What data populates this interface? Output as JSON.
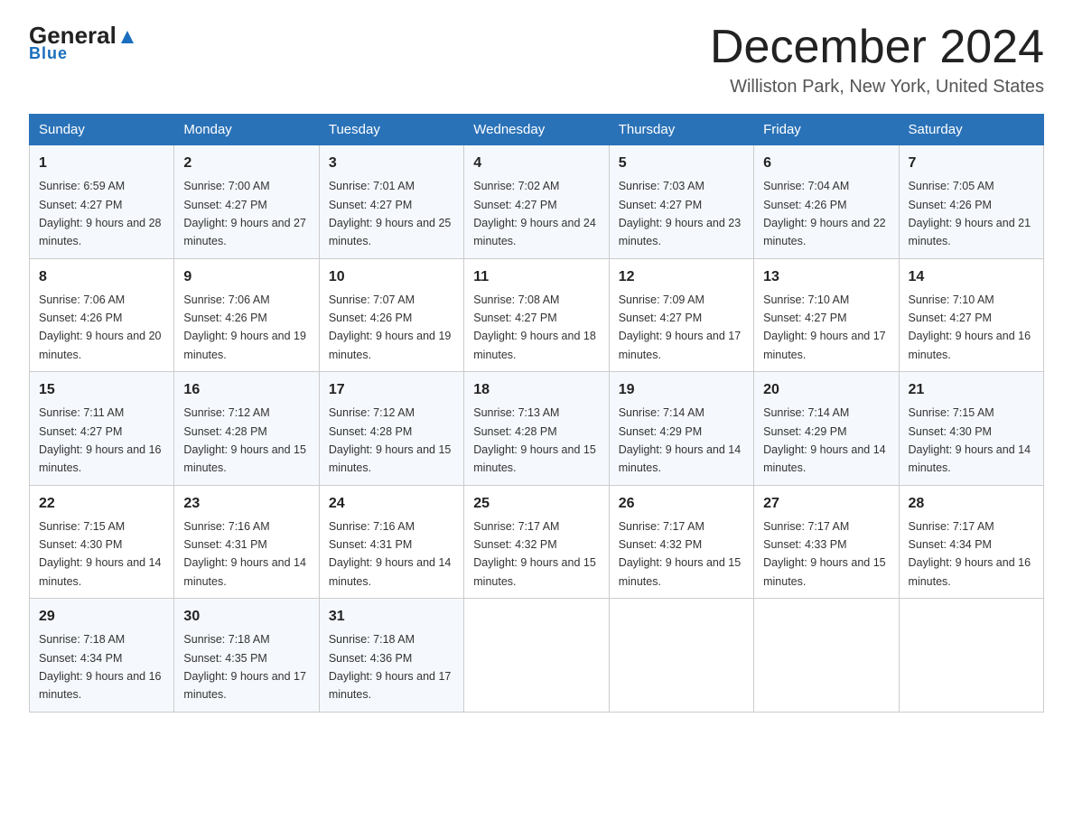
{
  "header": {
    "logo_general": "General",
    "logo_blue": "Blue",
    "month_title": "December 2024",
    "location": "Williston Park, New York, United States"
  },
  "days_of_week": [
    "Sunday",
    "Monday",
    "Tuesday",
    "Wednesday",
    "Thursday",
    "Friday",
    "Saturday"
  ],
  "weeks": [
    [
      {
        "day": "1",
        "sunrise": "6:59 AM",
        "sunset": "4:27 PM",
        "daylight": "9 hours and 28 minutes."
      },
      {
        "day": "2",
        "sunrise": "7:00 AM",
        "sunset": "4:27 PM",
        "daylight": "9 hours and 27 minutes."
      },
      {
        "day": "3",
        "sunrise": "7:01 AM",
        "sunset": "4:27 PM",
        "daylight": "9 hours and 25 minutes."
      },
      {
        "day": "4",
        "sunrise": "7:02 AM",
        "sunset": "4:27 PM",
        "daylight": "9 hours and 24 minutes."
      },
      {
        "day": "5",
        "sunrise": "7:03 AM",
        "sunset": "4:27 PM",
        "daylight": "9 hours and 23 minutes."
      },
      {
        "day": "6",
        "sunrise": "7:04 AM",
        "sunset": "4:26 PM",
        "daylight": "9 hours and 22 minutes."
      },
      {
        "day": "7",
        "sunrise": "7:05 AM",
        "sunset": "4:26 PM",
        "daylight": "9 hours and 21 minutes."
      }
    ],
    [
      {
        "day": "8",
        "sunrise": "7:06 AM",
        "sunset": "4:26 PM",
        "daylight": "9 hours and 20 minutes."
      },
      {
        "day": "9",
        "sunrise": "7:06 AM",
        "sunset": "4:26 PM",
        "daylight": "9 hours and 19 minutes."
      },
      {
        "day": "10",
        "sunrise": "7:07 AM",
        "sunset": "4:26 PM",
        "daylight": "9 hours and 19 minutes."
      },
      {
        "day": "11",
        "sunrise": "7:08 AM",
        "sunset": "4:27 PM",
        "daylight": "9 hours and 18 minutes."
      },
      {
        "day": "12",
        "sunrise": "7:09 AM",
        "sunset": "4:27 PM",
        "daylight": "9 hours and 17 minutes."
      },
      {
        "day": "13",
        "sunrise": "7:10 AM",
        "sunset": "4:27 PM",
        "daylight": "9 hours and 17 minutes."
      },
      {
        "day": "14",
        "sunrise": "7:10 AM",
        "sunset": "4:27 PM",
        "daylight": "9 hours and 16 minutes."
      }
    ],
    [
      {
        "day": "15",
        "sunrise": "7:11 AM",
        "sunset": "4:27 PM",
        "daylight": "9 hours and 16 minutes."
      },
      {
        "day": "16",
        "sunrise": "7:12 AM",
        "sunset": "4:28 PM",
        "daylight": "9 hours and 15 minutes."
      },
      {
        "day": "17",
        "sunrise": "7:12 AM",
        "sunset": "4:28 PM",
        "daylight": "9 hours and 15 minutes."
      },
      {
        "day": "18",
        "sunrise": "7:13 AM",
        "sunset": "4:28 PM",
        "daylight": "9 hours and 15 minutes."
      },
      {
        "day": "19",
        "sunrise": "7:14 AM",
        "sunset": "4:29 PM",
        "daylight": "9 hours and 14 minutes."
      },
      {
        "day": "20",
        "sunrise": "7:14 AM",
        "sunset": "4:29 PM",
        "daylight": "9 hours and 14 minutes."
      },
      {
        "day": "21",
        "sunrise": "7:15 AM",
        "sunset": "4:30 PM",
        "daylight": "9 hours and 14 minutes."
      }
    ],
    [
      {
        "day": "22",
        "sunrise": "7:15 AM",
        "sunset": "4:30 PM",
        "daylight": "9 hours and 14 minutes."
      },
      {
        "day": "23",
        "sunrise": "7:16 AM",
        "sunset": "4:31 PM",
        "daylight": "9 hours and 14 minutes."
      },
      {
        "day": "24",
        "sunrise": "7:16 AM",
        "sunset": "4:31 PM",
        "daylight": "9 hours and 14 minutes."
      },
      {
        "day": "25",
        "sunrise": "7:17 AM",
        "sunset": "4:32 PM",
        "daylight": "9 hours and 15 minutes."
      },
      {
        "day": "26",
        "sunrise": "7:17 AM",
        "sunset": "4:32 PM",
        "daylight": "9 hours and 15 minutes."
      },
      {
        "day": "27",
        "sunrise": "7:17 AM",
        "sunset": "4:33 PM",
        "daylight": "9 hours and 15 minutes."
      },
      {
        "day": "28",
        "sunrise": "7:17 AM",
        "sunset": "4:34 PM",
        "daylight": "9 hours and 16 minutes."
      }
    ],
    [
      {
        "day": "29",
        "sunrise": "7:18 AM",
        "sunset": "4:34 PM",
        "daylight": "9 hours and 16 minutes."
      },
      {
        "day": "30",
        "sunrise": "7:18 AM",
        "sunset": "4:35 PM",
        "daylight": "9 hours and 17 minutes."
      },
      {
        "day": "31",
        "sunrise": "7:18 AM",
        "sunset": "4:36 PM",
        "daylight": "9 hours and 17 minutes."
      },
      null,
      null,
      null,
      null
    ]
  ],
  "labels": {
    "sunrise_prefix": "Sunrise: ",
    "sunset_prefix": "Sunset: ",
    "daylight_prefix": "Daylight: "
  }
}
